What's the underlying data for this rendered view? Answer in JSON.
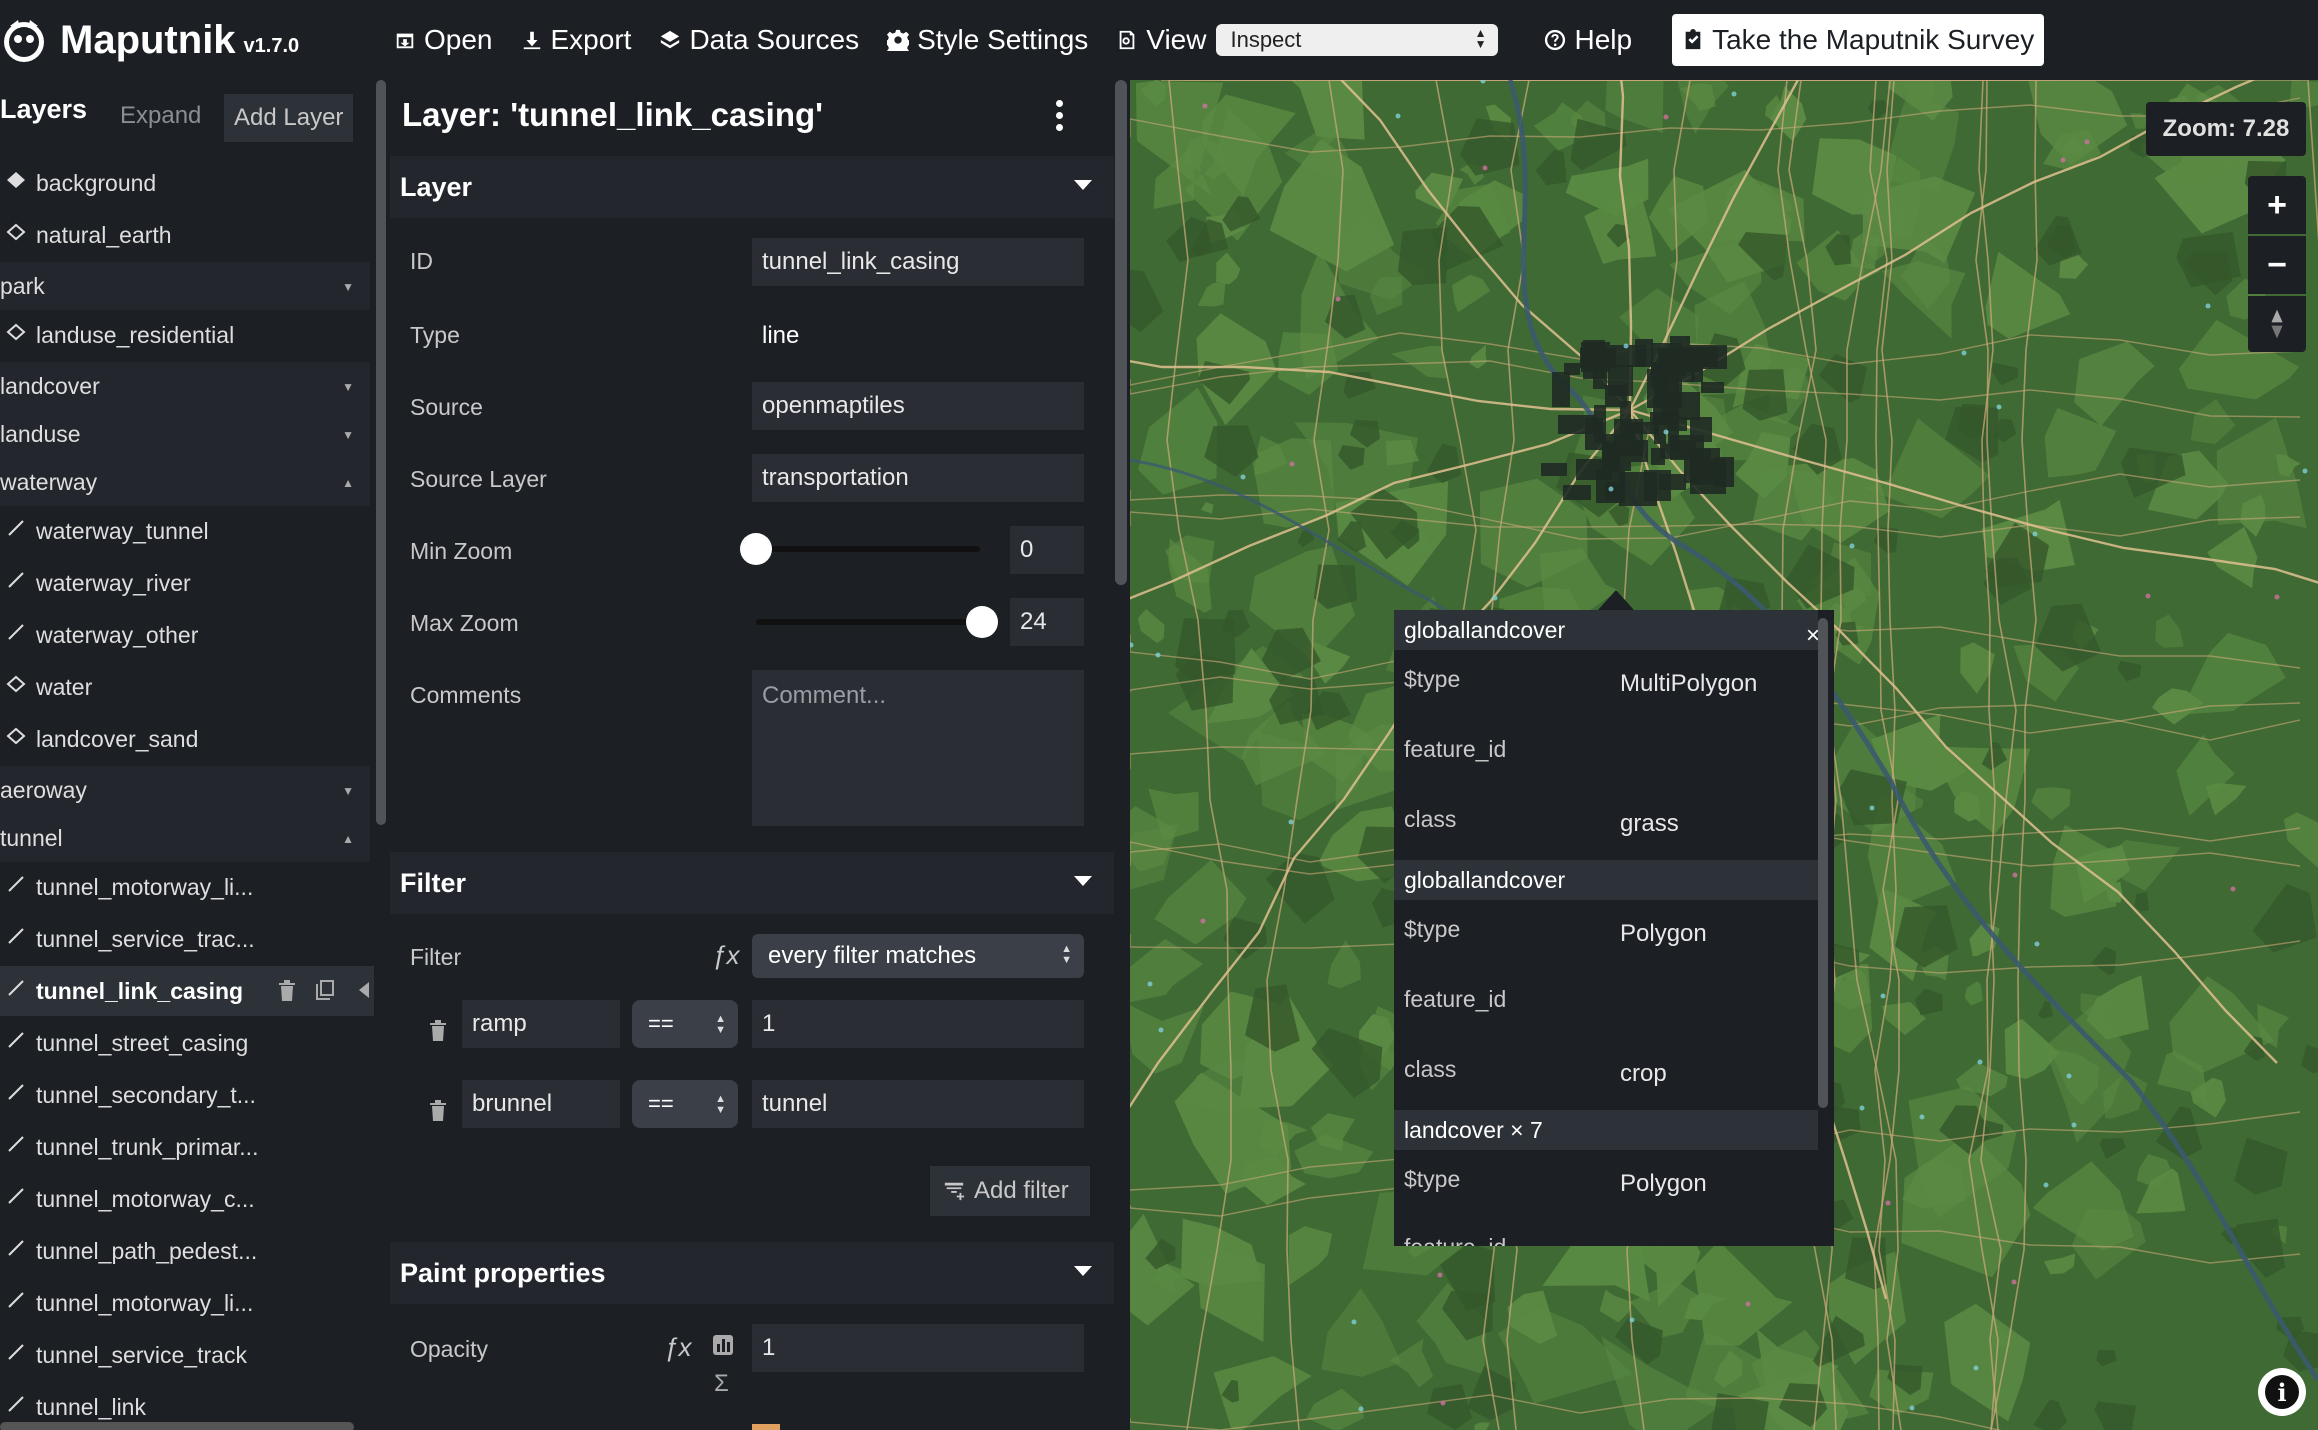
{
  "app": {
    "name": "Maputnik",
    "version": "v1.7.0"
  },
  "toolbar": {
    "open": "Open",
    "export": "Export",
    "data_sources": "Data Sources",
    "style_settings": "Style Settings",
    "view": "View",
    "view_mode": "Inspect",
    "help": "Help",
    "survey": "Take the Maputnik Survey"
  },
  "layer_list": {
    "title": "Layers",
    "expand": "Expand",
    "add_layer": "Add Layer",
    "items": [
      {
        "label": "background",
        "kind": "layer",
        "icon": "fill-diamond-icon"
      },
      {
        "label": "natural_earth",
        "kind": "layer",
        "icon": "diamond-outline-icon"
      },
      {
        "label": "park",
        "kind": "group",
        "expanded": false
      },
      {
        "label": "landuse_residential",
        "kind": "layer",
        "icon": "diamond-outline-icon"
      },
      {
        "label": "landcover",
        "kind": "group",
        "expanded": false
      },
      {
        "label": "landuse",
        "kind": "group",
        "expanded": false
      },
      {
        "label": "waterway",
        "kind": "group",
        "expanded": true
      },
      {
        "label": "waterway_tunnel",
        "kind": "layer",
        "icon": "line-icon"
      },
      {
        "label": "waterway_river",
        "kind": "layer",
        "icon": "line-icon"
      },
      {
        "label": "waterway_other",
        "kind": "layer",
        "icon": "line-icon"
      },
      {
        "label": "water",
        "kind": "layer",
        "icon": "diamond-outline-icon"
      },
      {
        "label": "landcover_sand",
        "kind": "layer",
        "icon": "diamond-outline-icon"
      },
      {
        "label": "aeroway",
        "kind": "group",
        "expanded": false
      },
      {
        "label": "tunnel",
        "kind": "group",
        "expanded": true
      },
      {
        "label": "tunnel_motorway_li...",
        "kind": "layer",
        "icon": "line-icon"
      },
      {
        "label": "tunnel_service_trac...",
        "kind": "layer",
        "icon": "line-icon"
      },
      {
        "label": "tunnel_link_casing",
        "kind": "layer",
        "icon": "line-icon",
        "selected": true
      },
      {
        "label": "tunnel_street_casing",
        "kind": "layer",
        "icon": "line-icon"
      },
      {
        "label": "tunnel_secondary_t...",
        "kind": "layer",
        "icon": "line-icon"
      },
      {
        "label": "tunnel_trunk_primar...",
        "kind": "layer",
        "icon": "line-icon"
      },
      {
        "label": "tunnel_motorway_c...",
        "kind": "layer",
        "icon": "line-icon"
      },
      {
        "label": "tunnel_path_pedest...",
        "kind": "layer",
        "icon": "line-icon"
      },
      {
        "label": "tunnel_motorway_li...",
        "kind": "layer",
        "icon": "line-icon"
      },
      {
        "label": "tunnel_service_track",
        "kind": "layer",
        "icon": "line-icon"
      },
      {
        "label": "tunnel_link",
        "kind": "layer",
        "icon": "line-icon"
      }
    ]
  },
  "editor": {
    "title": "Layer: 'tunnel_link_casing'",
    "layer_section": "Layer",
    "id_label": "ID",
    "id_value": "tunnel_link_casing",
    "type_label": "Type",
    "type_value": "line",
    "source_label": "Source",
    "source_value": "openmaptiles",
    "source_layer_label": "Source Layer",
    "source_layer_value": "transportation",
    "min_zoom_label": "Min Zoom",
    "min_zoom_value": "0",
    "max_zoom_label": "Max Zoom",
    "max_zoom_value": "24",
    "zoom_range_max": 24,
    "comments_label": "Comments",
    "comments_placeholder": "Comment...",
    "filter_section": "Filter",
    "filter_label": "Filter",
    "filter_mode": "every filter matches",
    "filters": [
      {
        "key": "ramp",
        "op": "==",
        "value": "1"
      },
      {
        "key": "brunnel",
        "op": "==",
        "value": "tunnel"
      }
    ],
    "add_filter": "Add filter",
    "paint_section": "Paint properties",
    "opacity_label": "Opacity",
    "opacity_value": "1"
  },
  "map": {
    "zoom_text": "Zoom: 7.28",
    "zoom_in": "+",
    "zoom_out": "−",
    "land_color": "#3f6a33",
    "forest_color": "#5a8a43",
    "road_color": "#c8a878",
    "urban_color": "#1f2a24"
  },
  "popup": {
    "close": "×",
    "features": [
      {
        "title": "globallandcover",
        "rows": [
          {
            "k": "$type",
            "v": "MultiPolygon"
          },
          {
            "k": "feature_id",
            "v": ""
          },
          {
            "k": "class",
            "v": "grass"
          }
        ]
      },
      {
        "title": "globallandcover",
        "rows": [
          {
            "k": "$type",
            "v": "Polygon"
          },
          {
            "k": "feature_id",
            "v": ""
          },
          {
            "k": "class",
            "v": "crop"
          }
        ]
      },
      {
        "title": "landcover × 7",
        "rows": [
          {
            "k": "$type",
            "v": "Polygon"
          },
          {
            "k": "feature_id",
            "v": ""
          }
        ]
      }
    ]
  }
}
